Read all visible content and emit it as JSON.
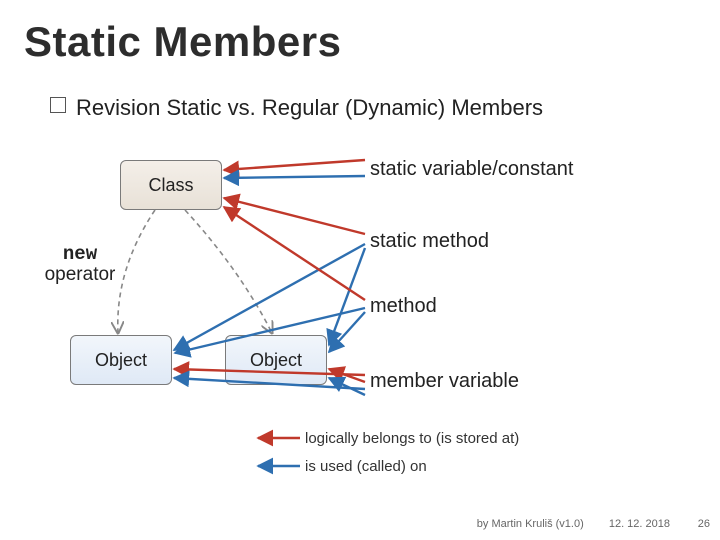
{
  "title": "Static Members",
  "subtitle": {
    "revision": "Revision",
    "rest": "Static vs. Regular (Dynamic) Members"
  },
  "boxes": {
    "class": "Class",
    "object1": "Object",
    "object2": "Object"
  },
  "newOperator": {
    "kw": "new",
    "word": "operator"
  },
  "labels": {
    "staticVar": "static variable/constant",
    "staticMethod": "static method",
    "method": "method",
    "memberVar": "member variable"
  },
  "legend": {
    "belongs": "logically belongs to (is stored at)",
    "used": "is used (called) on"
  },
  "footer": {
    "author": "by Martin Kruliš (v1.0)",
    "date": "12. 12. 2018"
  },
  "pageNumber": "26"
}
